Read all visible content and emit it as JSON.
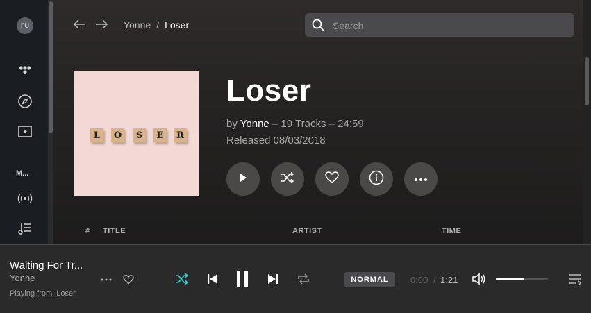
{
  "sidebar": {
    "avatar": "FU",
    "section_label": "M...",
    "icons": [
      "tidal-logo-icon",
      "compass-icon",
      "video-icon",
      "radio-icon",
      "playlist-icon"
    ]
  },
  "header": {
    "breadcrumb": [
      "Yonne",
      "Loser"
    ],
    "search_placeholder": "Search"
  },
  "album": {
    "cover_letters": [
      "L",
      "O",
      "S",
      "E",
      "R"
    ],
    "title": "Loser",
    "by": "by",
    "artist": "Yonne",
    "summary": "– 19 Tracks – 24:59",
    "released": "Released 08/03/2018"
  },
  "track_table": {
    "columns": [
      "#",
      "TITLE",
      "ARTIST",
      "TIME"
    ]
  },
  "player": {
    "title": "Waiting For Tr...",
    "artist": "Yonne",
    "playing_from_label": "Playing from:",
    "playing_from_value": "Loser",
    "quality": "NORMAL",
    "time_current": "0:00",
    "time_separator": "/",
    "time_total": "1:21",
    "volume": 0.55,
    "accent_color": "#2ad4d4"
  }
}
